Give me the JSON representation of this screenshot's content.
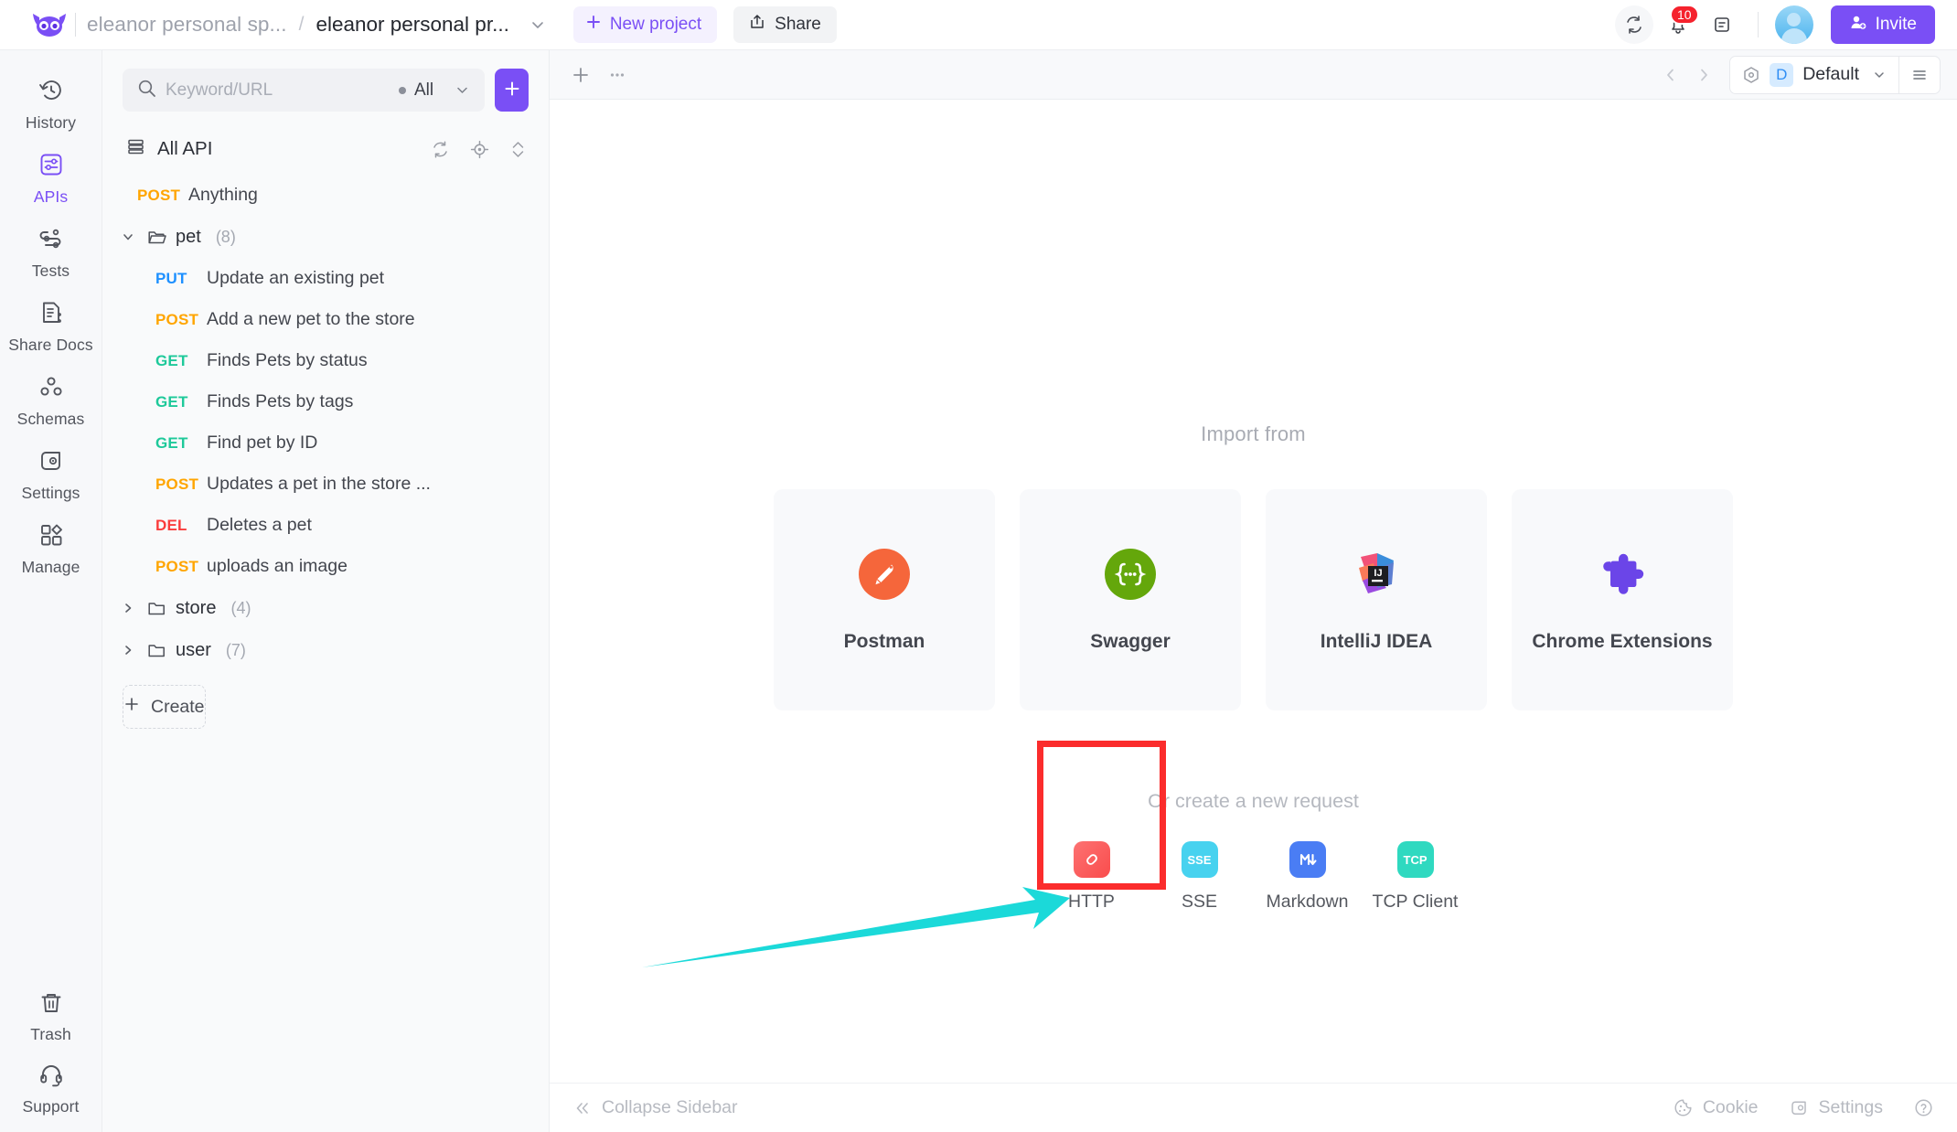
{
  "header": {
    "workspace": "eleanor personal sp...",
    "separator": "/",
    "project": "eleanor personal pr...",
    "new_project_label": "New project",
    "share_label": "Share",
    "invite_label": "Invite",
    "notification_count": "10",
    "icons": {
      "logo": "owl-logo-icon",
      "sync": "sync-icon",
      "bell": "bell-icon",
      "notes": "notes-icon",
      "avatar": "avatar",
      "invite": "add-user-icon",
      "caret": "chevron-down-icon"
    },
    "accent_color": "#7a4ff5"
  },
  "rail": {
    "items": [
      {
        "label": "History",
        "icon": "history-icon",
        "active": false
      },
      {
        "label": "APIs",
        "icon": "apis-icon",
        "active": true
      },
      {
        "label": "Tests",
        "icon": "tests-icon",
        "active": false
      },
      {
        "label": "Share Docs",
        "icon": "share-docs-icon",
        "active": false
      },
      {
        "label": "Schemas",
        "icon": "schemas-icon",
        "active": false
      },
      {
        "label": "Settings",
        "icon": "settings-icon",
        "active": false
      },
      {
        "label": "Manage",
        "icon": "manage-icon",
        "active": false
      }
    ],
    "bottom": [
      {
        "label": "Trash",
        "icon": "trash-icon"
      },
      {
        "label": "Support",
        "icon": "headset-icon"
      }
    ]
  },
  "sidebar": {
    "search_placeholder": "Keyword/URL",
    "search_value": "",
    "filter_label": "All",
    "add_button": "+",
    "all_api_label": "All API",
    "all_api_actions": [
      "refresh-icon",
      "locate-icon",
      "sort-icon"
    ],
    "create_label": "Create",
    "tree": [
      {
        "type": "api",
        "method": "POST",
        "name": "Anything",
        "indent": 0
      },
      {
        "type": "folder",
        "name": "pet",
        "count": "(8)",
        "expanded": true
      },
      {
        "type": "api",
        "method": "PUT",
        "name": "Update an existing pet",
        "indent": 1
      },
      {
        "type": "api",
        "method": "POST",
        "name": "Add a new pet to the store",
        "indent": 1
      },
      {
        "type": "api",
        "method": "GET",
        "name": "Finds Pets by status",
        "indent": 1
      },
      {
        "type": "api",
        "method": "GET",
        "name": "Finds Pets by tags",
        "indent": 1
      },
      {
        "type": "api",
        "method": "GET",
        "name": "Find pet by ID",
        "indent": 1
      },
      {
        "type": "api",
        "method": "POST",
        "name": "Updates a pet in the store ...",
        "indent": 1
      },
      {
        "type": "api",
        "method": "DEL",
        "name": "Deletes a pet",
        "indent": 1
      },
      {
        "type": "api",
        "method": "POST",
        "name": "uploads an image",
        "indent": 1
      },
      {
        "type": "folder",
        "name": "store",
        "count": "(4)",
        "expanded": false
      },
      {
        "type": "folder",
        "name": "user",
        "count": "(7)",
        "expanded": false
      }
    ],
    "method_colors": {
      "POST": "#ffa500",
      "PUT": "#1e90ff",
      "GET": "#1ec99a",
      "DEL": "#fa3c3c"
    }
  },
  "main": {
    "toolbar": {
      "add_tab": "+",
      "more": "...",
      "prev": "chevron-left-icon",
      "next": "chevron-right-icon",
      "env_icon": "environment-icon",
      "env_tag": "D",
      "env_name": "Default",
      "env_caret": "chevron-down-icon",
      "env_menu": "hamburger-icon"
    },
    "import_title": "Import from",
    "import_cards": [
      {
        "label": "Postman",
        "icon": "postman-icon"
      },
      {
        "label": "Swagger",
        "icon": "swagger-icon"
      },
      {
        "label": "IntelliJ IDEA",
        "icon": "intellij-idea-icon"
      },
      {
        "label": "Chrome Extensions",
        "icon": "chrome-extensions-icon"
      }
    ],
    "or_title": "Or create a new request",
    "request_types": [
      {
        "label": "HTTP",
        "icon": "http-icon",
        "highlighted": true
      },
      {
        "label": "SSE",
        "icon": "sse-icon",
        "highlighted": false
      },
      {
        "label": "Markdown",
        "icon": "markdown-icon",
        "highlighted": false
      },
      {
        "label": "TCP Client",
        "icon": "tcp-icon",
        "highlighted": false
      }
    ],
    "footer": {
      "collapse_label": "Collapse Sidebar",
      "cookie_label": "Cookie",
      "settings_label": "Settings",
      "help_icon": "help-icon"
    }
  },
  "annotations": {
    "highlight_color": "#fb2c2c",
    "arrow_color": "#1bd9d9",
    "target": "HTTP"
  }
}
